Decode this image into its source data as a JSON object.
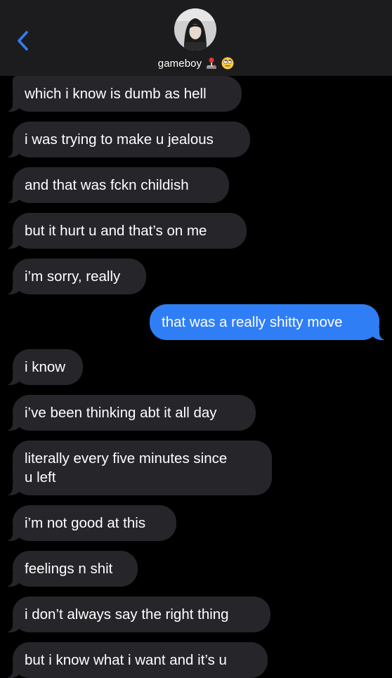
{
  "header": {
    "contact_name": "gameboy",
    "back_icon": "chevron-left-icon",
    "emojis": [
      "joystick-emoji",
      "rolling-eyes-emoji"
    ]
  },
  "colors": {
    "header_bg": "#1c1c1e",
    "received_bubble": "#26252a",
    "sent_bubble": "#2f7ef6",
    "accent": "#2f7ef6",
    "background": "#000000"
  },
  "messages": [
    {
      "from": "them",
      "text": "which i know is dumb as hell"
    },
    {
      "from": "them",
      "text": "i was trying to make u jealous"
    },
    {
      "from": "them",
      "text": "and that was fckn childish"
    },
    {
      "from": "them",
      "text": "but it hurt u and that’s on me"
    },
    {
      "from": "them",
      "text": "i’m sorry, really"
    },
    {
      "from": "me",
      "text": "that was a really shitty move"
    },
    {
      "from": "them",
      "text": "i know"
    },
    {
      "from": "them",
      "text": "i’ve been thinking abt it all day"
    },
    {
      "from": "them",
      "text": "literally every five minutes since\nu left"
    },
    {
      "from": "them",
      "text": "i’m not good at this"
    },
    {
      "from": "them",
      "text": "feelings n shit"
    },
    {
      "from": "them",
      "text": "i don’t always say the right thing"
    },
    {
      "from": "them",
      "text": "but i know what i want and it’s u"
    }
  ]
}
